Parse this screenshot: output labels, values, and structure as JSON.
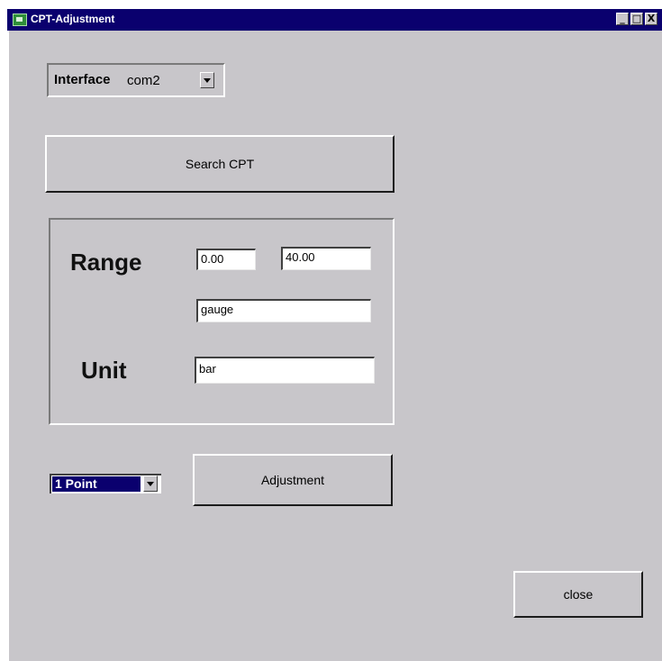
{
  "window": {
    "title": "CPT-Adjustment",
    "minimize_glyph": "_",
    "maximize_glyph": "□",
    "close_glyph": "X"
  },
  "interface": {
    "label": "Interface",
    "selected": "com2"
  },
  "search_button": {
    "label": "Search CPT"
  },
  "range_group": {
    "range_label": "Range",
    "range_min": "0.00",
    "range_max": "40.00",
    "pressure_type": "gauge",
    "unit_label": "Unit",
    "unit_value": "bar"
  },
  "point_select": {
    "selected": "1 Point"
  },
  "adjustment_button": {
    "label": "Adjustment"
  },
  "close_button": {
    "label": "close"
  },
  "colors": {
    "titlebar": "#0a006e",
    "window_bg": "#c8c6ca",
    "selection": "#0a006e"
  }
}
